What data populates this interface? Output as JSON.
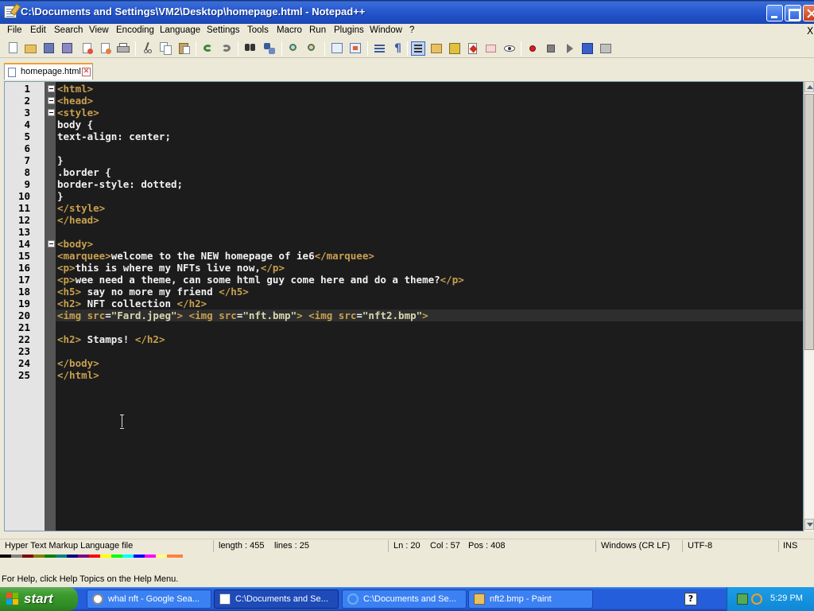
{
  "window": {
    "title": "C:\\Documents and Settings\\VM2\\Desktop\\homepage.html - Notepad++"
  },
  "menu": [
    {
      "label": "File",
      "id": "file"
    },
    {
      "label": "Edit",
      "id": "edit"
    },
    {
      "label": "Search",
      "id": "search"
    },
    {
      "label": "View",
      "id": "view"
    },
    {
      "label": "Encoding",
      "id": "encoding"
    },
    {
      "label": "Language",
      "id": "language"
    },
    {
      "label": "Settings",
      "id": "settings"
    },
    {
      "label": "Tools",
      "id": "tools"
    },
    {
      "label": "Macro",
      "id": "macro"
    },
    {
      "label": "Run",
      "id": "run"
    },
    {
      "label": "Plugins",
      "id": "plugins"
    },
    {
      "label": "Window",
      "id": "window"
    },
    {
      "label": "?",
      "id": "help"
    }
  ],
  "menu_close": "X",
  "toolbar": [
    "new-file-icon",
    "open-file-icon",
    "save-icon",
    "save-all-icon",
    "close-icon",
    "close-all-icon",
    "print-icon",
    "cut-icon",
    "copy-icon",
    "paste-icon",
    "undo-icon",
    "redo-icon",
    "find-icon",
    "replace-icon",
    "zoom-in-icon",
    "zoom-out-icon",
    "sync-vertical-icon",
    "sync-horizontal-icon",
    "word-wrap-icon",
    "show-all-characters-icon",
    "indent-guide-icon",
    "document-map-icon",
    "function-list-icon",
    "folder-workspace-icon",
    "monitoring-icon",
    "eye-icon",
    "record-macro-icon",
    "stop-macro-icon",
    "play-macro-icon",
    "run-macro-multiple-icon",
    "save-macro-icon"
  ],
  "tabs": [
    {
      "label": "homepage.html",
      "close": "✕",
      "active": true
    }
  ],
  "editor": {
    "lines": [
      {
        "n": "1",
        "fold": true,
        "segs": [
          {
            "t": "<html>",
            "c": "tag"
          }
        ]
      },
      {
        "n": "2",
        "fold": true,
        "segs": [
          {
            "t": "<head>",
            "c": "tag"
          }
        ]
      },
      {
        "n": "3",
        "fold": true,
        "segs": [
          {
            "t": "<style>",
            "c": "tag"
          }
        ]
      },
      {
        "n": "4",
        "fold": false,
        "segs": [
          {
            "t": "body {",
            "c": "txt"
          }
        ]
      },
      {
        "n": "5",
        "fold": false,
        "segs": [
          {
            "t": "text-align: center;",
            "c": "txt"
          }
        ]
      },
      {
        "n": "6",
        "fold": false,
        "segs": []
      },
      {
        "n": "7",
        "fold": false,
        "segs": [
          {
            "t": "}",
            "c": "txt"
          }
        ]
      },
      {
        "n": "8",
        "fold": false,
        "segs": [
          {
            "t": ".border {",
            "c": "txt"
          }
        ]
      },
      {
        "n": "9",
        "fold": false,
        "segs": [
          {
            "t": "border-style: dotted;",
            "c": "txt"
          }
        ]
      },
      {
        "n": "10",
        "fold": false,
        "segs": [
          {
            "t": "}",
            "c": "txt"
          }
        ]
      },
      {
        "n": "11",
        "fold": false,
        "segs": [
          {
            "t": "</style>",
            "c": "tag"
          }
        ]
      },
      {
        "n": "12",
        "fold": false,
        "segs": [
          {
            "t": "</head>",
            "c": "tag"
          }
        ]
      },
      {
        "n": "13",
        "fold": false,
        "segs": []
      },
      {
        "n": "14",
        "fold": true,
        "segs": [
          {
            "t": "<body>",
            "c": "tag"
          }
        ]
      },
      {
        "n": "15",
        "fold": false,
        "segs": [
          {
            "t": "<marquee>",
            "c": "tag"
          },
          {
            "t": "welcome to the NEW homepage of ie6",
            "c": "txt"
          },
          {
            "t": "</marquee>",
            "c": "tag"
          }
        ]
      },
      {
        "n": "16",
        "fold": false,
        "segs": [
          {
            "t": "<p>",
            "c": "tag"
          },
          {
            "t": "this is where my NFTs live now,",
            "c": "txt"
          },
          {
            "t": "</p>",
            "c": "tag"
          }
        ]
      },
      {
        "n": "17",
        "fold": false,
        "segs": [
          {
            "t": "<p>",
            "c": "tag"
          },
          {
            "t": "wee need a theme, can some html guy come here and do a theme?",
            "c": "txt"
          },
          {
            "t": "</p>",
            "c": "tag"
          }
        ]
      },
      {
        "n": "18",
        "fold": false,
        "segs": [
          {
            "t": "<h5>",
            "c": "tag"
          },
          {
            "t": " say no more my friend ",
            "c": "txt"
          },
          {
            "t": "</h5>",
            "c": "tag"
          }
        ]
      },
      {
        "n": "19",
        "fold": false,
        "segs": [
          {
            "t": "<h2>",
            "c": "tag"
          },
          {
            "t": " NFT collection ",
            "c": "txt"
          },
          {
            "t": "</h2>",
            "c": "tag"
          }
        ]
      },
      {
        "n": "20",
        "fold": false,
        "segs": [
          {
            "t": "<img ",
            "c": "tag"
          },
          {
            "t": "src",
            "c": "attr"
          },
          {
            "t": "=",
            "c": "txt"
          },
          {
            "t": "\"Fard.jpeg\"",
            "c": "str"
          },
          {
            "t": ">",
            "c": "tag"
          },
          {
            "t": " ",
            "c": "txt"
          },
          {
            "t": "<img ",
            "c": "tag"
          },
          {
            "t": "src",
            "c": "attr"
          },
          {
            "t": "=",
            "c": "txt"
          },
          {
            "t": "\"nft.bmp\"",
            "c": "str"
          },
          {
            "t": ">",
            "c": "tag"
          },
          {
            "t": " ",
            "c": "txt"
          },
          {
            "t": "<img ",
            "c": "tag"
          },
          {
            "t": "src",
            "c": "attr"
          },
          {
            "t": "=",
            "c": "txt"
          },
          {
            "t": "\"nft2.bmp\"",
            "c": "str"
          },
          {
            "t": ">",
            "c": "tag"
          }
        ]
      },
      {
        "n": "21",
        "fold": false,
        "segs": []
      },
      {
        "n": "22",
        "fold": false,
        "segs": [
          {
            "t": "<h2>",
            "c": "tag"
          },
          {
            "t": " Stamps! ",
            "c": "txt"
          },
          {
            "t": "</h2>",
            "c": "tag"
          }
        ]
      },
      {
        "n": "23",
        "fold": false,
        "segs": []
      },
      {
        "n": "24",
        "fold": false,
        "segs": [
          {
            "t": "</body>",
            "c": "tag"
          }
        ]
      },
      {
        "n": "25",
        "fold": false,
        "segs": [
          {
            "t": "</html>",
            "c": "tag"
          }
        ]
      }
    ],
    "current_line": "20"
  },
  "status": {
    "file_type": "Hyper Text Markup Language file",
    "length": "length : 455",
    "lines": "lines : 25",
    "ln": "Ln : 20",
    "col": "Col : 57",
    "pos": "Pos : 408",
    "eol": "Windows (CR LF)",
    "encoding": "UTF-8",
    "mode": "INS"
  },
  "help_text": "For Help, click Help Topics on the Help Menu.",
  "taskbar": {
    "start": "start",
    "tasks": [
      {
        "label": "whal nft - Google Sea...",
        "icon": "browser-icon",
        "active": false
      },
      {
        "label": "C:\\Documents and Se...",
        "icon": "notepad-icon",
        "active": true
      },
      {
        "label": "C:\\Documents and Se...",
        "icon": "internet-explorer-icon",
        "active": false
      },
      {
        "label": "nft2.bmp - Paint",
        "icon": "paint-icon",
        "active": false
      }
    ],
    "clock": "5:29 PM",
    "help_icon": "?"
  }
}
